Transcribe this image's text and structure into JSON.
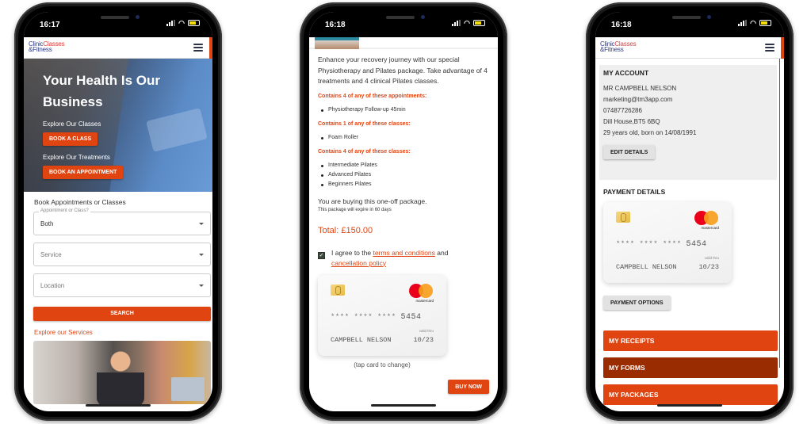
{
  "colors": {
    "accent": "#e04410",
    "accent_dark": "#9a2c02",
    "logo_blue": "#2b3a84",
    "logo_red": "#e03c3c"
  },
  "phones": [
    {
      "status": {
        "time": "16:17"
      },
      "header": {
        "logo_line1_a": "Clinic",
        "logo_line1_b": "Classes",
        "logo_line2": "&Fitness",
        "menu_icon": "hamburger-icon"
      },
      "hero": {
        "title": "Your Health Is Our Business",
        "classes_label": "Explore Our Classes",
        "book_class_button": "BOOK A CLASS",
        "treatments_label": "Explore Our Treatments",
        "book_appointment_button": "BOOK AN APPOINTMENT"
      },
      "booking": {
        "title": "Book Appointments or Classes",
        "type_field": {
          "legend": "Appointment or Class?",
          "value": "Both"
        },
        "service_field": {
          "placeholder": "Service"
        },
        "location_field": {
          "placeholder": "Location"
        },
        "search_button": "SEARCH"
      },
      "explore_link": "Explore our Services"
    },
    {
      "status": {
        "time": "16:18"
      },
      "package": {
        "intro": "Enhance your recovery journey with our special Physiotherapy and Pilates package. Take advantage of 4 treatments and 4 clinical Pilates classes.",
        "groups": [
          {
            "heading": "Contains 4 of any of these appointments:",
            "items": [
              "Physiotherapy Follow-up 45min"
            ]
          },
          {
            "heading": "Contains 1 of any of these classes:",
            "items": [
              "Foam Roller"
            ]
          },
          {
            "heading": "Contains 4 of any of these classes:",
            "items": [
              "Intermediate Pilates",
              "Advanced Pilates",
              "Beginners Pilates"
            ]
          }
        ],
        "buying_text": "You are buying this one-off package.",
        "expire_text": "This package will expire in 60 days",
        "total": "Total: £150.00",
        "agree_prefix": "I agree to the",
        "terms_link": "terms and conditions",
        "agree_mid": "and",
        "cancellation_link": "cancellation policy",
        "agreed": true,
        "tap_note": "(tap card to change)",
        "buy_button": "BUY NOW"
      }
    },
    {
      "status": {
        "time": "16:18"
      },
      "account": {
        "heading": "MY ACCOUNT",
        "name": "MR CAMPBELL NELSON",
        "email": "marketing@tm3app.com",
        "phone": "07487726286",
        "address": "Dill House,BT5 6BQ",
        "age_dob": "29 years old, born on 14/08/1991",
        "edit_button": "EDIT DETAILS"
      },
      "payment": {
        "heading": "PAYMENT DETAILS",
        "options_button": "PAYMENT OPTIONS"
      },
      "menu": [
        "MY RECEIPTS",
        "MY FORMS",
        "MY PACKAGES"
      ]
    }
  ],
  "card": {
    "brand": "mastercard",
    "masked": "**** **** ****",
    "last4": "5454",
    "holder": "CAMPBELL NELSON",
    "valid_label": "valid thru",
    "expiry": "10/23"
  }
}
